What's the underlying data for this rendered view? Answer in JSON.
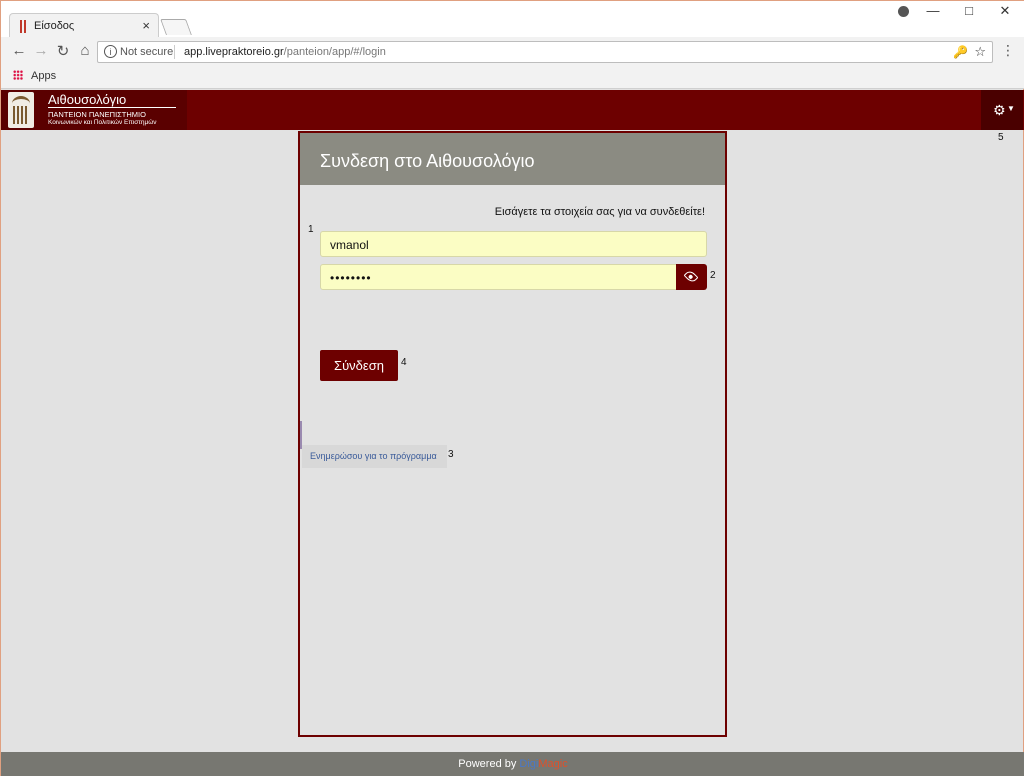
{
  "browser": {
    "tab_title": "Είσοδος",
    "tab_close": "×",
    "security_label": "Not secure",
    "url_host": "app.livepraktoreio.gr",
    "url_path": "/panteion/app/#/login",
    "bookmarks_apps_label": "Apps"
  },
  "header": {
    "brand_title": "Αιθουσολόγιο",
    "brand_subtitle1": "ΠΑΝΤΕΙΟΝ ΠΑΝΕΠΙΣΤΗΜΙΟ",
    "brand_subtitle2": "Κοινωνικών και Πολιτικών Επιστημών",
    "settings_icon": "gear-icon"
  },
  "login": {
    "title": "Συνδεση στο Αιθουσολόγιο",
    "instruction": "Εισάγετε τα στοιχεία σας για να συνδεθείτε!",
    "username_value": "vmanol",
    "password_value": "••••••••",
    "submit_label": "Σύνδεση",
    "inform_link": "Ενημερώσου για το πρόγραμμα"
  },
  "markers": [
    "1",
    "2",
    "3",
    "4",
    "5"
  ],
  "footer": {
    "powered_by": "Powered by",
    "brand_part1": "Digi",
    "brand_part2": "Magic"
  },
  "colors": {
    "primary": "#6d0000",
    "card_header": "#8b8b82",
    "field_bg": "#fbfdc4",
    "background": "#e2e2e2"
  }
}
